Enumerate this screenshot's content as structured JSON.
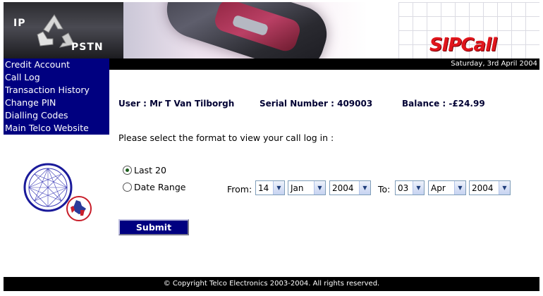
{
  "header": {
    "logo_left_top": "IP",
    "logo_left_bottom": "PSTN",
    "brand": "SIPCall",
    "date": "Saturday, 3rd April 2004"
  },
  "nav": {
    "items": [
      {
        "label": "Credit Account"
      },
      {
        "label": "Call Log"
      },
      {
        "label": "Transaction History"
      },
      {
        "label": "Change PIN"
      },
      {
        "label": "Dialling Codes"
      },
      {
        "label": "Main Telco Website"
      }
    ]
  },
  "account": {
    "user": "User : Mr T Van Tilborgh",
    "serial": "Serial Number : 409003",
    "balance": "Balance : -£24.99"
  },
  "form": {
    "prompt": "Please select the format to view your call log in :",
    "option_last": "Last 20",
    "option_range": "Date Range",
    "selected": "Last 20",
    "from_label": "From:",
    "to_label": "To:",
    "from_day": "14",
    "from_month": "Jan",
    "from_year": "2004",
    "to_day": "03",
    "to_month": "Apr",
    "to_year": "2004",
    "submit_label": "Submit"
  },
  "footer": {
    "copyright": "© Copyright Telco Electronics 2003-2004. All rights reserved."
  },
  "colors": {
    "nav_bg": "#000080",
    "brand_red": "#e0151c",
    "bar_black": "#000000"
  }
}
